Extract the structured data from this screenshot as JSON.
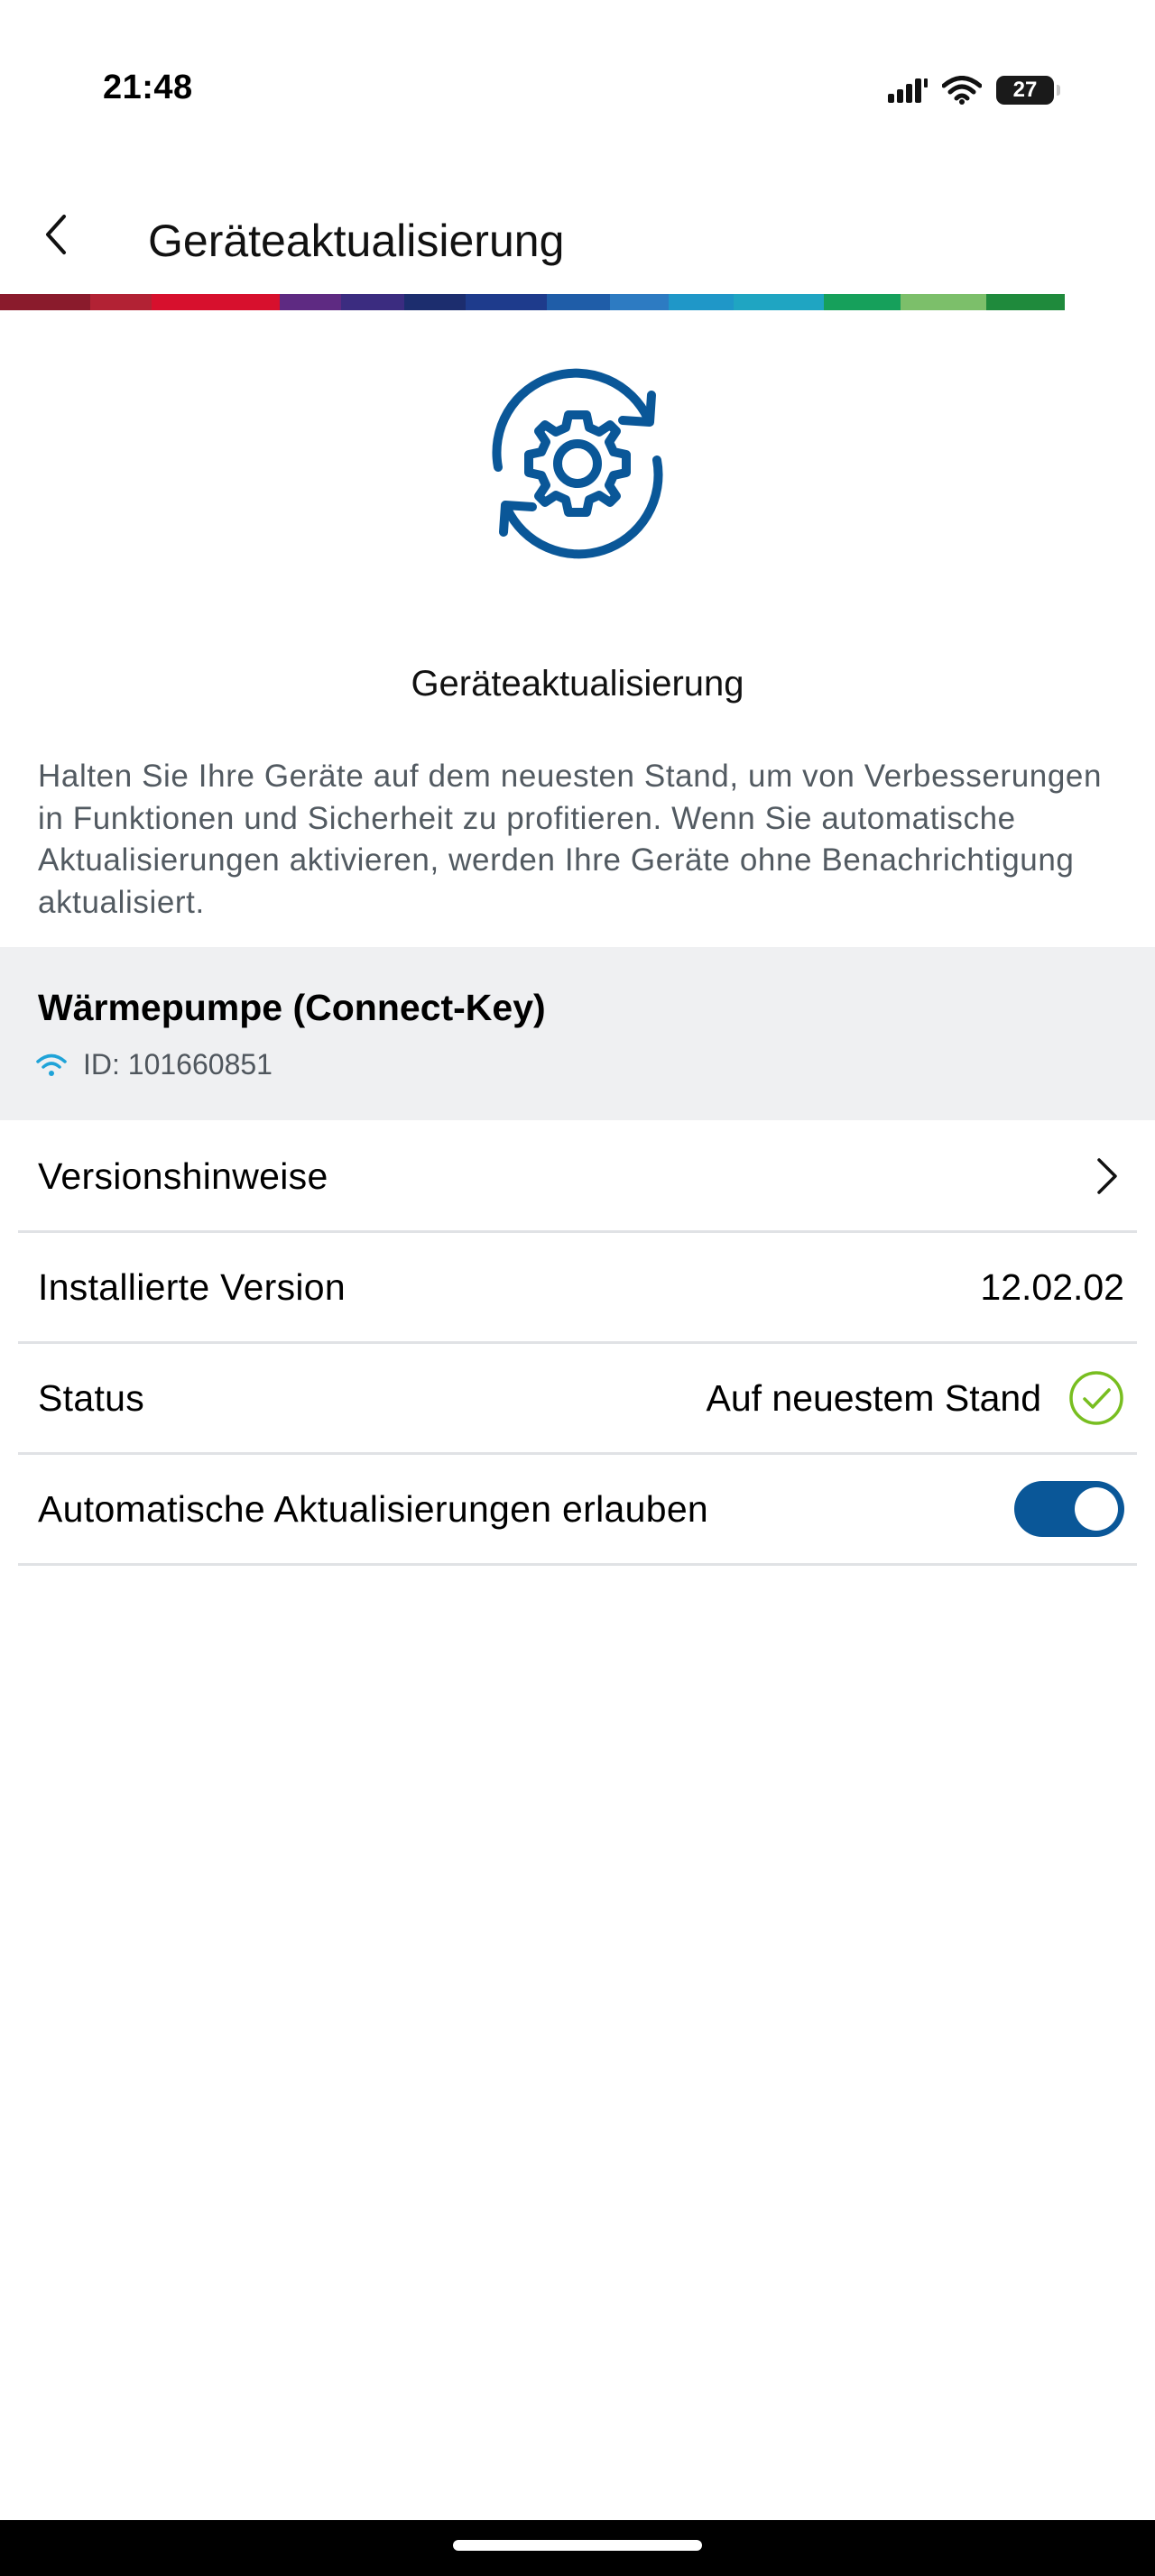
{
  "status_bar": {
    "time": "21:48",
    "battery": "27",
    "icons": [
      "signal-icon",
      "wifi-icon",
      "battery-icon"
    ]
  },
  "header": {
    "back_icon": "chevron-left-icon",
    "title": "Geräteaktualisierung"
  },
  "brand_stripe_colors": [
    "#8a1b2c",
    "#b22234",
    "#d7102d",
    "#5e2a82",
    "#3b2c80",
    "#1c2d6e",
    "#1e3b8c",
    "#1f5da8",
    "#2d7bc2",
    "#1f97c8",
    "#1fa5c2",
    "#16a05b",
    "#7cbf6a",
    "#1f8a3c"
  ],
  "hero": {
    "icon": "gear-sync-icon",
    "title": "Geräteaktualisierung",
    "description": "Halten Sie Ihre Geräte auf dem neuesten Stand, um von Verbesserungen in Funktionen und Sicherheit zu profitieren. Wenn Sie automatische Aktualisierungen aktivieren, werden Ihre Geräte ohne Benachrichtigung aktualisiert."
  },
  "device": {
    "name": "Wärmepumpe (Connect-Key)",
    "connection_icon": "wifi-icon",
    "id": "ID: 101660851"
  },
  "rows": {
    "release_notes": {
      "label": "Versionshinweise",
      "icon": "chevron-right-icon"
    },
    "installed_version": {
      "label": "Installierte Version",
      "value": "12.02.02"
    },
    "status": {
      "label": "Status",
      "value": "Auf neuestem Stand",
      "icon": "check-circle-icon"
    },
    "auto_update": {
      "label": "Automatische Aktualisierungen erlauben",
      "enabled": true
    }
  },
  "colors": {
    "accent": "#0a5798",
    "icon_blue": "#0a5798",
    "wifi_blue": "#1fa3d8",
    "success_green": "#78be20",
    "card_background": "#eff0f2"
  }
}
